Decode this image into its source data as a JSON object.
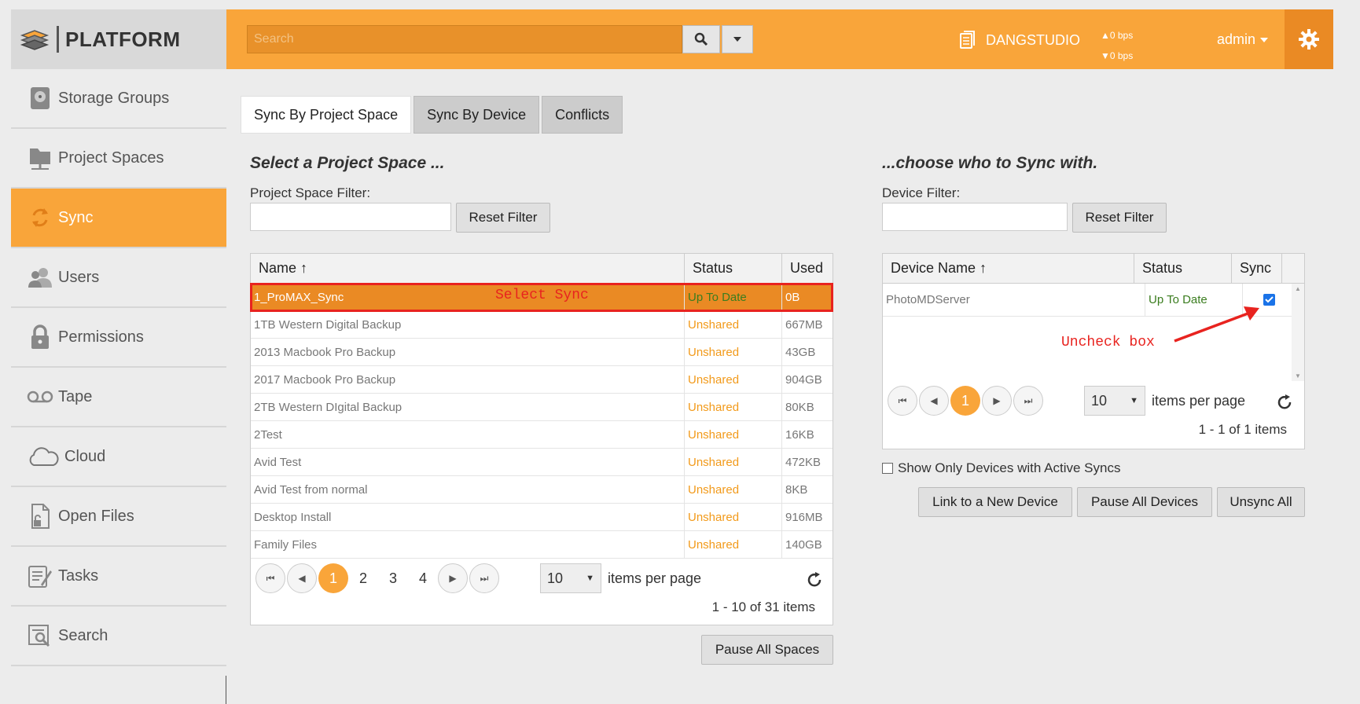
{
  "brand": {
    "logo": "PLATFORM"
  },
  "header": {
    "search_placeholder": "Search",
    "server_name": "DANGSTUDIO",
    "up_rate": "▲0 bps",
    "down_rate": "▼0 bps",
    "user": "admin"
  },
  "sidebar": {
    "items": [
      {
        "label": "Storage Groups",
        "icon": "storage-icon",
        "active": false
      },
      {
        "label": "Project Spaces",
        "icon": "folder-icon",
        "active": false
      },
      {
        "label": "Sync",
        "icon": "sync-icon",
        "active": true
      },
      {
        "label": "Users",
        "icon": "users-icon",
        "active": false
      },
      {
        "label": "Permissions",
        "icon": "lock-icon",
        "active": false
      },
      {
        "label": "Tape",
        "icon": "tape-icon",
        "active": false
      },
      {
        "label": "Cloud",
        "icon": "cloud-icon",
        "active": false
      },
      {
        "label": "Open Files",
        "icon": "open-file-icon",
        "active": false
      },
      {
        "label": "Tasks",
        "icon": "tasks-icon",
        "active": false
      },
      {
        "label": "Search",
        "icon": "search-doc-icon",
        "active": false
      }
    ]
  },
  "tabs": [
    "Sync By Project Space",
    "Sync By Device",
    "Conflicts"
  ],
  "left": {
    "heading": "Select a Project Space ...",
    "filter_label": "Project Space Filter:",
    "reset_label": "Reset Filter",
    "columns": [
      "Name ↑",
      "Status",
      "Used"
    ],
    "rows": [
      {
        "name": "1_ProMAX_Sync",
        "status": "Up To Date",
        "used": "0B"
      },
      {
        "name": "1TB Western Digital Backup",
        "status": "Unshared",
        "used": "667MB"
      },
      {
        "name": "2013 Macbook Pro Backup",
        "status": "Unshared",
        "used": "43GB"
      },
      {
        "name": "2017 Macbook Pro Backup",
        "status": "Unshared",
        "used": "904GB"
      },
      {
        "name": "2TB Western DIgital Backup",
        "status": "Unshared",
        "used": "80KB"
      },
      {
        "name": "2Test",
        "status": "Unshared",
        "used": "16KB"
      },
      {
        "name": "Avid Test",
        "status": "Unshared",
        "used": "472KB"
      },
      {
        "name": "Avid Test from normal",
        "status": "Unshared",
        "used": "8KB"
      },
      {
        "name": "Desktop Install",
        "status": "Unshared",
        "used": "916MB"
      },
      {
        "name": "Family Files",
        "status": "Unshared",
        "used": "140GB"
      }
    ],
    "pages": [
      "1",
      "2",
      "3",
      "4"
    ],
    "page_size": "10",
    "items_per_page": "items per page",
    "summary": "1 - 10 of 31 items",
    "pause_label": "Pause All Spaces",
    "annotation": "Select Sync"
  },
  "right": {
    "heading": "...choose who to Sync with.",
    "filter_label": "Device Filter:",
    "reset_label": "Reset Filter",
    "columns": [
      "Device Name ↑",
      "Status",
      "Sync"
    ],
    "rows": [
      {
        "name": "PhotoMDServer",
        "status": "Up To Date",
        "sync": true
      }
    ],
    "pages": [
      "1"
    ],
    "page_size": "10",
    "items_per_page": "items per page",
    "summary": "1 - 1 of 1 items",
    "show_only_label": "Show Only Devices with Active Syncs",
    "link_label": "Link to a New Device",
    "pause_label": "Pause All Devices",
    "unsync_label": "Unsync All",
    "annotation": "Uncheck box"
  },
  "colors": {
    "accent": "#f9a53a",
    "accent_dark": "#ea8a24",
    "unshared": "#f29a1a",
    "up_to_date": "#3b7d1f",
    "annotation": "#e8231f"
  }
}
